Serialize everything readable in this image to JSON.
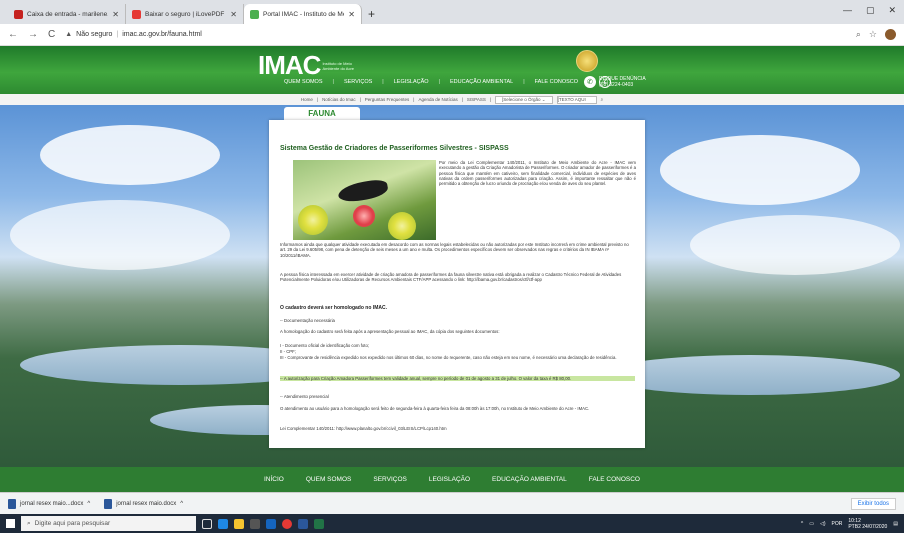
{
  "browser": {
    "tabs": [
      {
        "title": "Caixa de entrada - marilene.h...",
        "favicon_color": "#c5221f"
      },
      {
        "title": "Baixar o seguro | iLovePDF",
        "favicon_color": "#e53935"
      },
      {
        "title": "Portal IMAC - Instituto de Meio",
        "favicon_color": "#4caf50",
        "active": true
      }
    ],
    "new_tab": "+",
    "address": {
      "security": "Não seguro",
      "url": "imac.ac.gov.br/fauna.html"
    }
  },
  "header": {
    "logo_text": "IMAC",
    "logo_sub": "Instituto de Meio Ambiente do Acre",
    "nav": [
      "QUEM SOMOS",
      "SERVIÇOS",
      "LEGISLAÇÃO",
      "EDUCAÇÃO AMBIENTAL",
      "FALE CONOSCO"
    ],
    "disque_title": "DISQUE DENÚNCIA",
    "disque_phone": "(68) 3224-0403"
  },
  "subnav": {
    "items": [
      "Home",
      "Notícias do Imac",
      "Perguntas Frequentes",
      "Agenda de Notícias",
      "SISPASS"
    ],
    "select": "[Selecione o Órgão",
    "search_placeholder": "[TEXTO AQUI"
  },
  "page": {
    "section_tab": "FAUNA",
    "title": "Sistema Gestão de Criadores de Passeriformes Silvestres - SISPASS",
    "intro_right": "Por meio da Lei Complementar 140/2011, o Instituto de Meio Ambiente do Acre - IMAC vem executando a gestão da Criação Amadorista de Passeriformes. O criador amador de passeriformes é a pessoa física que mantém em cativeiro, sem finalidade comercial, indivíduos de espécies de aves nativas da ordem passeriformes autorizadas para criação. Assim, é importante ressaltar que não é permitido a obtenção de lucro oriundo de procriação e/ou venda de aves do seu plantel.",
    "para1": "Informamos ainda que qualquer atividade executada em desacordo com as normas legais estabelecidas ou não autorizadas por este Instituto incorrerá em crime ambiental previsto no art. 29 da Lei 9.605/98, com pena de detenção de seis meses a um ano e multa. Os procedimentos específicos devem ser observados nas regras e critérios da IN IBAMA nº 10/2011/IBAMA.",
    "para2": "A pessoa física interessada em exercer atividade de criação amadora de passeriformes da fauna silvestre nativa está obrigada a realizar o Cadastro Técnico Federal de Atividades Potencialmente Poluidoras e/ou Utilizadoras de Recursos Ambientais CTF/APP acessando o link: http://ibama.gov.br/cadastros/ctf/ctf-app",
    "heading2": "O cadastro deverá ser homologado no IMAC.",
    "docs_heading": "-- Documentação necessária",
    "docs_intro": "A homologação do cadastro será feita após a apresentação pessoal ao IMAC, da cópia dos seguintes documentos:",
    "doc_items": [
      "I - Documento oficial de identificação com foto;",
      "II - CPF;",
      "III - Comprovante de residência expedido nos expedido nos últimos 60 dias, no nome do requerente, caso não esteja em seu nome, é necessário uma declaração de residência."
    ],
    "highlight": "-- A autorização para Criação Amadora Passeriformes tem validade anual, sempre no período de 01 de agosto a 31 de julho. O valor da taxa é R$ 80,00.",
    "attend_heading": "-- Atendimento presencial",
    "attend_text": "O atendimento ao usuário para a homologação será feito de segunda-feira à quarta-feira feira da 08:00h às 17:00h, no Instituto de Meio Ambiente do Acre - IMAC.",
    "law_link": "Lei Complementar 140/2011: http://www.planalto.gov.br/ccivil_03/LEIS/LCP/Lcp140.htm"
  },
  "footer": {
    "nav": [
      "INÍCIO",
      "QUEM SOMOS",
      "SERVIÇOS",
      "LEGISLAÇÃO",
      "EDUCAÇÃO AMBIENTAL",
      "FALE CONOSCO"
    ]
  },
  "downloads": {
    "items": [
      "jornal resex maio...docx",
      "jornal resex maio.docx"
    ],
    "show_all": "Exibir todos"
  },
  "taskbar": {
    "search_placeholder": "Digite aqui para pesquisar",
    "lang": "POR",
    "time": "10:12",
    "date": "PTB2  24/07/2020"
  }
}
